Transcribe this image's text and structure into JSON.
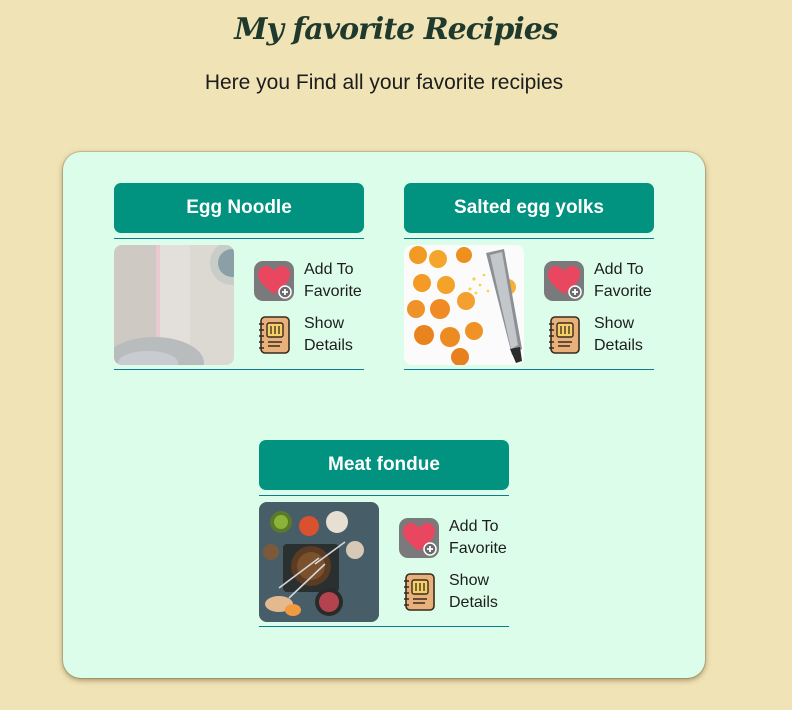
{
  "page": {
    "title": "My favorite Recipies",
    "subtitle": "Here you Find all your favorite recipies"
  },
  "recipes": [
    {
      "name": "Egg Noodle",
      "add_label_1": "Add To",
      "add_label_2": "Favorite",
      "details_label_1": "Show",
      "details_label_2": "Details"
    },
    {
      "name": "Salted egg yolks",
      "add_label_1": "Add To",
      "add_label_2": "Favorite",
      "details_label_1": "Show",
      "details_label_2": "Details"
    },
    {
      "name": "Meat fondue",
      "add_label_1": "Add To",
      "add_label_2": "Favorite",
      "details_label_1": "Show",
      "details_label_2": "Details"
    }
  ],
  "icons": {
    "favorite": "heart-plus-icon",
    "details": "recipe-book-icon"
  },
  "colors": {
    "background": "#f0e3b6",
    "panel": "#dcfde9",
    "card_header": "#01937f",
    "title": "#1f3a2c"
  }
}
